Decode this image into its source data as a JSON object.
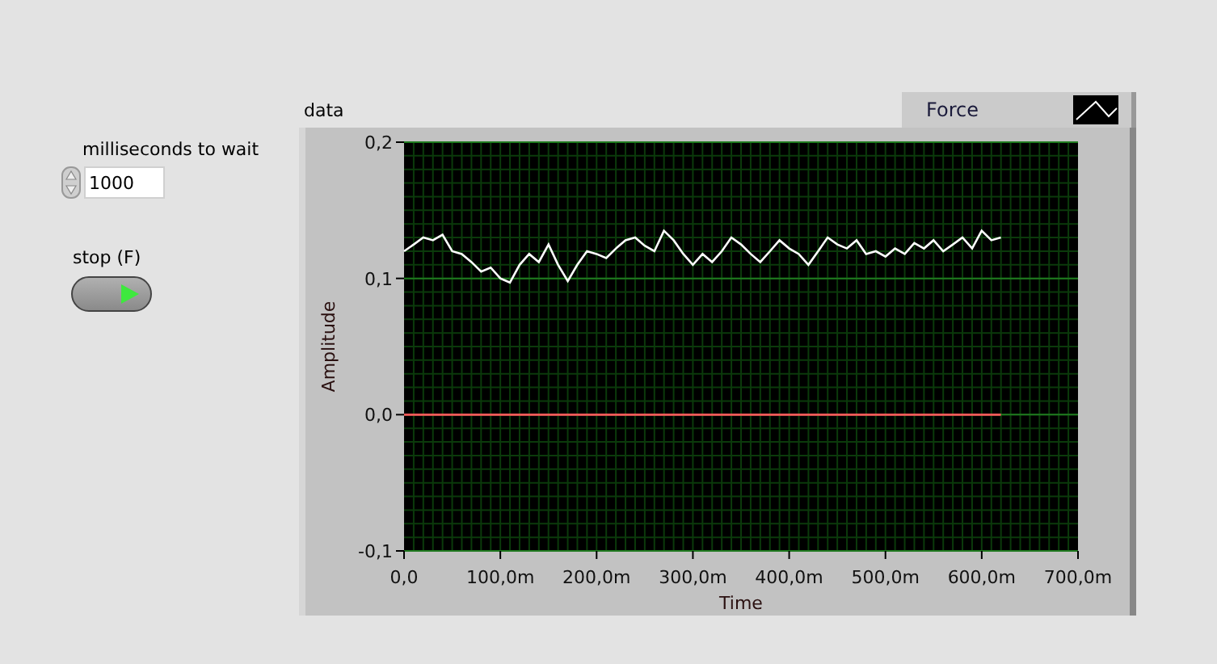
{
  "controls": {
    "wait": {
      "label": "milliseconds to wait",
      "value": "1000"
    },
    "stop": {
      "label": "stop (F)"
    }
  },
  "graph": {
    "label": "data",
    "chart_data": {
      "type": "line",
      "xlabel": "Time",
      "ylabel": "Amplitude",
      "x": [
        0,
        10,
        20,
        30,
        40,
        50,
        60,
        70,
        80,
        90,
        100,
        110,
        120,
        130,
        140,
        150,
        160,
        170,
        180,
        190,
        200,
        210,
        220,
        230,
        240,
        250,
        260,
        270,
        280,
        290,
        300,
        310,
        320,
        330,
        340,
        350,
        360,
        370,
        380,
        390,
        400,
        410,
        420,
        430,
        440,
        450,
        460,
        470,
        480,
        490,
        500,
        510,
        520,
        530,
        540,
        550,
        560,
        570,
        580,
        590,
        600,
        610,
        620
      ],
      "series": [
        {
          "name": "Force",
          "color": "#ffffff",
          "values": [
            0.12,
            0.125,
            0.13,
            0.128,
            0.132,
            0.12,
            0.118,
            0.112,
            0.105,
            0.108,
            0.1,
            0.097,
            0.11,
            0.118,
            0.112,
            0.125,
            0.11,
            0.098,
            0.11,
            0.12,
            0.118,
            0.115,
            0.122,
            0.128,
            0.13,
            0.124,
            0.12,
            0.135,
            0.128,
            0.118,
            0.11,
            0.118,
            0.112,
            0.12,
            0.13,
            0.125,
            0.118,
            0.112,
            0.12,
            0.128,
            0.122,
            0.118,
            0.11,
            0.12,
            0.13,
            0.125,
            0.122,
            0.128,
            0.118,
            0.12,
            0.116,
            0.122,
            0.118,
            0.126,
            0.122,
            0.128,
            0.12,
            0.125,
            0.13,
            0.122,
            0.135,
            0.128,
            0.13
          ]
        },
        {
          "color": "#ff5a5a",
          "values": [
            0,
            0,
            0,
            0,
            0,
            0,
            0,
            0,
            0,
            0,
            0,
            0,
            0,
            0,
            0,
            0,
            0,
            0,
            0,
            0,
            0,
            0,
            0,
            0,
            0,
            0,
            0,
            0,
            0,
            0,
            0,
            0,
            0,
            0,
            0,
            0,
            0,
            0,
            0,
            0,
            0,
            0,
            0,
            0,
            0,
            0,
            0,
            0,
            0,
            0,
            0,
            0,
            0,
            0,
            0,
            0,
            0,
            0,
            0,
            0,
            0,
            0,
            0
          ]
        }
      ],
      "grid": true,
      "xlim": [
        0,
        700
      ],
      "ylim": [
        -0.1,
        0.2
      ],
      "xticks": [
        {
          "value": 0,
          "label": "0,0"
        },
        {
          "value": 100,
          "label": "100,0m"
        },
        {
          "value": 200,
          "label": "200,0m"
        },
        {
          "value": 300,
          "label": "300,0m"
        },
        {
          "value": 400,
          "label": "400,0m"
        },
        {
          "value": 500,
          "label": "500,0m"
        },
        {
          "value": 600,
          "label": "600,0m"
        },
        {
          "value": 700,
          "label": "700,0m"
        }
      ],
      "yticks": [
        {
          "value": 0.2,
          "label": "0,2"
        },
        {
          "value": 0.1,
          "label": "0,1"
        },
        {
          "value": 0,
          "label": "0,0"
        },
        {
          "value": -0.1,
          "label": "-0,1"
        }
      ]
    }
  }
}
